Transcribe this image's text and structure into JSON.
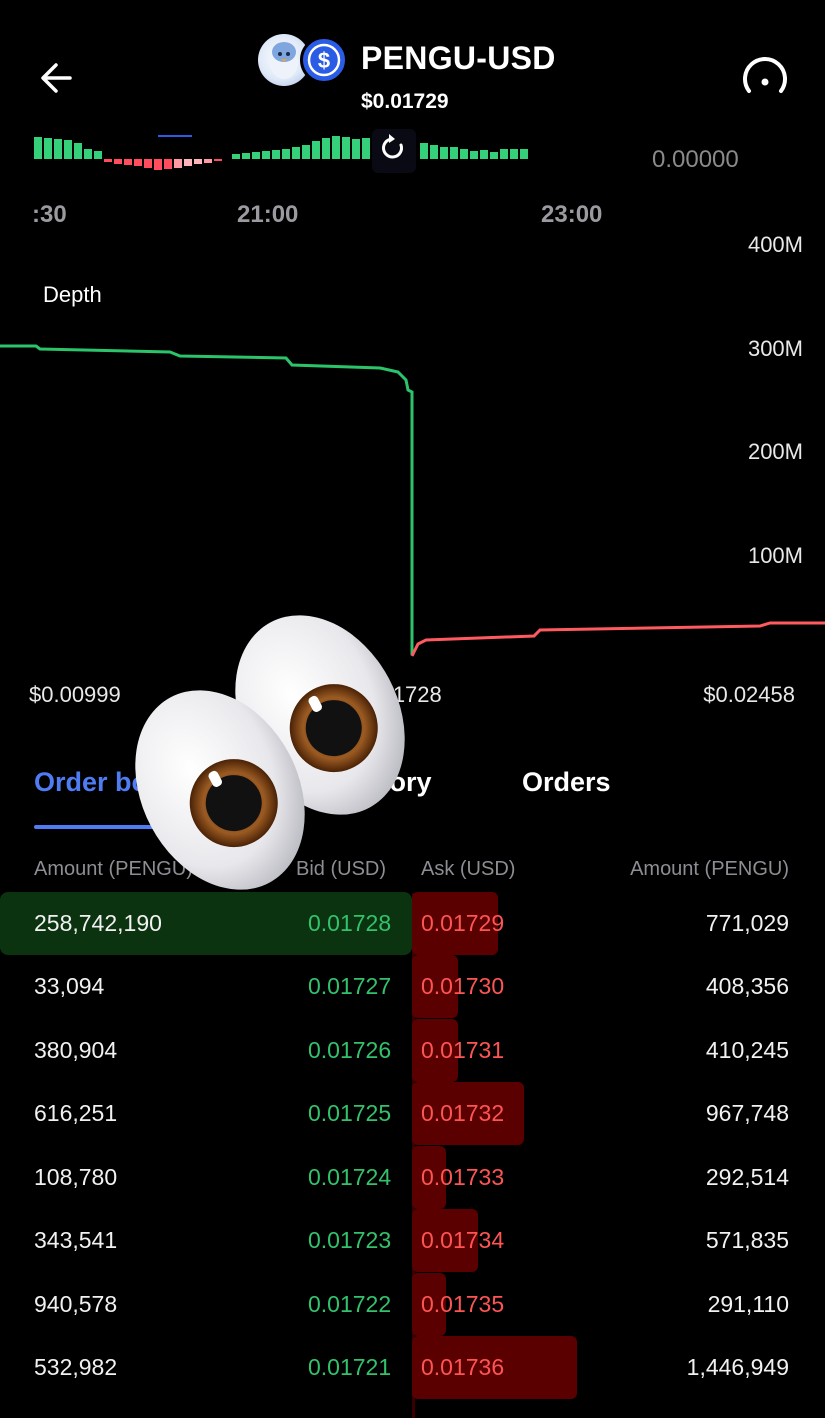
{
  "header": {
    "title": "PENGU-USD",
    "price": "$0.01729",
    "quote_icon_glyph": "$",
    "mini_value": "0.00000"
  },
  "colors": {
    "accent_blue": "#4f7cf3",
    "bid_green": "#33c26c",
    "ask_red": "#ff5454"
  },
  "timeline": {
    "labels": [
      ":30",
      "21:00",
      "23:00"
    ]
  },
  "depth": {
    "title": "Depth",
    "y_ticks": [
      "400M",
      "300M",
      "200M",
      "100M"
    ],
    "x_ticks": [
      "$0.00999",
      "$0.01728",
      "$0.02458"
    ]
  },
  "tabs": [
    {
      "label": "Order book",
      "active": true
    },
    {
      "label": "Trade history",
      "active": false
    },
    {
      "label": "Orders",
      "active": false
    }
  ],
  "order_book": {
    "headers": {
      "amount_left": "Amount (PENGU)",
      "bid": "Bid (USD)",
      "ask": "Ask (USD)",
      "amount_right": "Amount (PENGU)"
    },
    "rows": [
      {
        "bid_amount": "258,742,190",
        "bid": "0.01728",
        "ask": "0.01729",
        "ask_amount": "771,029",
        "bid_depth": 1.0,
        "ask_depth": 0.53
      },
      {
        "bid_amount": "33,094",
        "bid": "0.01727",
        "ask": "0.01730",
        "ask_amount": "408,356",
        "bid_depth": 0.0,
        "ask_depth": 0.28
      },
      {
        "bid_amount": "380,904",
        "bid": "0.01726",
        "ask": "0.01731",
        "ask_amount": "410,245",
        "bid_depth": 0.0,
        "ask_depth": 0.28
      },
      {
        "bid_amount": "616,251",
        "bid": "0.01725",
        "ask": "0.01732",
        "ask_amount": "967,748",
        "bid_depth": 0.0,
        "ask_depth": 0.67
      },
      {
        "bid_amount": "108,780",
        "bid": "0.01724",
        "ask": "0.01733",
        "ask_amount": "292,514",
        "bid_depth": 0.0,
        "ask_depth": 0.2
      },
      {
        "bid_amount": "343,541",
        "bid": "0.01723",
        "ask": "0.01734",
        "ask_amount": "571,835",
        "bid_depth": 0.0,
        "ask_depth": 0.39
      },
      {
        "bid_amount": "940,578",
        "bid": "0.01722",
        "ask": "0.01735",
        "ask_amount": "291,110",
        "bid_depth": 0.0,
        "ask_depth": 0.2
      },
      {
        "bid_amount": "532,982",
        "bid": "0.01721",
        "ask": "0.01736",
        "ask_amount": "1,446,949",
        "bid_depth": 0.0,
        "ask_depth": 1.0
      }
    ]
  },
  "icons": {
    "back": "arrow-left-icon",
    "gauge": "gauge-icon",
    "refresh": "refresh-icon",
    "overlay": "eyes-emoji"
  }
}
